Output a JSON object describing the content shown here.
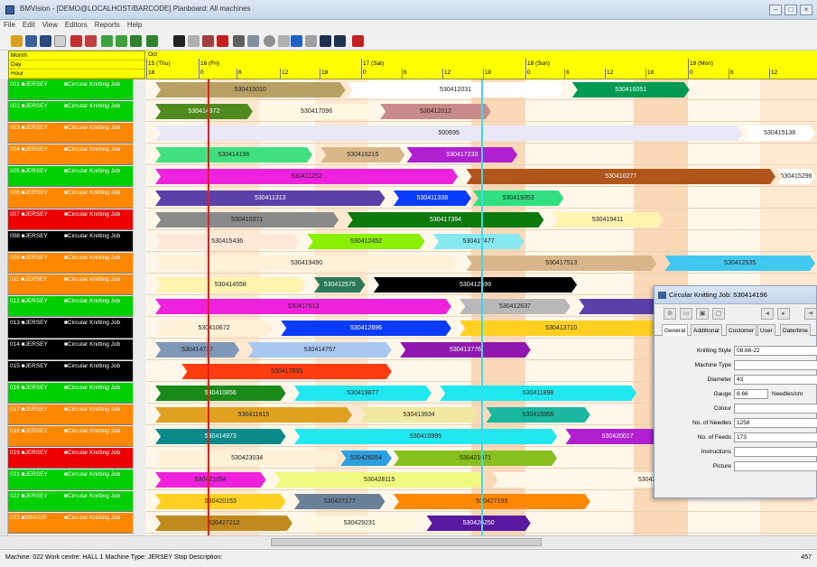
{
  "window": {
    "title": "BMVision - [DEMO@LOCALHOST/BARCODE] Planboard: All machines"
  },
  "menu": [
    "File",
    "Edit",
    "View",
    "Editors",
    "Reports",
    "Help"
  ],
  "timeline": {
    "labels": {
      "month": "Month",
      "day": "Day",
      "hour": "Hour"
    },
    "month": "Oct",
    "days": [
      "15 (Thu)",
      "16 (Fri)",
      "17 (Sat)",
      "18 (Sun)",
      "19 (Mon)"
    ],
    "hours": [
      "18",
      "0",
      "6",
      "12",
      "18",
      "0",
      "6",
      "12",
      "18",
      "0",
      "6",
      "12",
      "18",
      "0",
      "6",
      "12"
    ]
  },
  "machines": [
    {
      "id": "001",
      "type": "JERSEY",
      "job": "Circular Knitting Job",
      "color": "#00d000"
    },
    {
      "id": "002",
      "type": "JERSEY",
      "job": "Circular Knitting Job",
      "color": "#00d000"
    },
    {
      "id": "003",
      "type": "JERSEY",
      "job": "Circular Knitting Job",
      "color": "#ff8800"
    },
    {
      "id": "004",
      "type": "JERSEY",
      "job": "Circular Knitting Job",
      "color": "#ff8800"
    },
    {
      "id": "005",
      "type": "JERSEY",
      "job": "Circular Knitting Job",
      "color": "#00d000"
    },
    {
      "id": "006",
      "type": "JERSEY",
      "job": "Circular Knitting Job",
      "color": "#ff8800"
    },
    {
      "id": "007",
      "type": "JERSEY",
      "job": "Circular Knitting Job",
      "color": "#ee0000"
    },
    {
      "id": "008",
      "type": "JERSEY",
      "job": "Circular Knitting Job",
      "color": "#000000"
    },
    {
      "id": "009",
      "type": "JERSEY",
      "job": "Circular Knitting Job",
      "color": "#ff8800"
    },
    {
      "id": "011",
      "type": "JERSEY",
      "job": "Circular Knitting Job",
      "color": "#ff8800"
    },
    {
      "id": "012",
      "type": "JERSEY",
      "job": "Circular Knitting Job",
      "color": "#00d000"
    },
    {
      "id": "013",
      "type": "JERSEY",
      "job": "Circular Knitting Job",
      "color": "#000000"
    },
    {
      "id": "014",
      "type": "JERSEY",
      "job": "Circular Knitting Job",
      "color": "#000000"
    },
    {
      "id": "015",
      "type": "JERSEY",
      "job": "Circular Knitting Job",
      "color": "#000000"
    },
    {
      "id": "016",
      "type": "JERSEY",
      "job": "Circular Knitting Job",
      "color": "#00d000"
    },
    {
      "id": "017",
      "type": "JERSEY",
      "job": "Circular Knitting Job",
      "color": "#ff8800"
    },
    {
      "id": "018",
      "type": "JERSEY",
      "job": "Circular Knitting Job",
      "color": "#ff8800"
    },
    {
      "id": "019",
      "type": "JERSEY",
      "job": "Circular Knitting Job",
      "color": "#ee0000"
    },
    {
      "id": "021",
      "type": "JERSEY",
      "job": "Circular Knitting Job",
      "color": "#00d000"
    },
    {
      "id": "022",
      "type": "JERSEY",
      "job": "Circular Knitting Job",
      "color": "#00d000"
    },
    {
      "id": "023",
      "type": "SINKER",
      "job": "Circular Knitting Job",
      "color": "#ff8800"
    }
  ],
  "jobs": [
    [
      {
        "label": "530415010",
        "color": "#b8a062",
        "s": 0.0,
        "e": 0.29
      },
      {
        "label": "530412031",
        "color": "#ffffff",
        "s": 0.29,
        "e": 0.62
      },
      {
        "label": "530416051",
        "color": "#009a52",
        "s": 0.63,
        "e": 0.81
      }
    ],
    [
      {
        "label": "530414372",
        "color": "#4f8a1f",
        "s": 0.0,
        "e": 0.15
      },
      {
        "label": "530417096",
        "color": "#fff7e0",
        "s": 0.16,
        "e": 0.33
      },
      {
        "label": "530412012",
        "color": "#c98a8a",
        "s": 0.34,
        "e": 0.51
      }
    ],
    [
      {
        "label": "500695",
        "color": "#e8e8f8",
        "s": 0.0,
        "e": 0.89
      },
      {
        "label": "530415138",
        "color": "#ffffff",
        "s": 0.89,
        "e": 1.0
      }
    ],
    [
      {
        "label": "530414196",
        "color": "#40e080",
        "s": 0.0,
        "e": 0.24
      },
      {
        "label": "530416215",
        "color": "#d8b68a",
        "s": 0.25,
        "e": 0.38
      },
      {
        "label": "530417233",
        "color": "#b020d0",
        "s": 0.38,
        "e": 0.55
      }
    ],
    [
      {
        "label": "530411252",
        "color": "#ee22dd",
        "s": 0.0,
        "e": 0.46
      },
      {
        "label": "530410277",
        "color": "#b0551c",
        "s": 0.47,
        "e": 0.94
      },
      {
        "label": "530415296",
        "color": "#ffffff",
        "s": 0.94,
        "e": 1.0
      }
    ],
    [
      {
        "label": "530411313",
        "color": "#5a40a8",
        "s": 0.0,
        "e": 0.35
      },
      {
        "label": "530411338",
        "color": "#0a3cff",
        "s": 0.36,
        "e": 0.48
      },
      {
        "label": "530419353",
        "color": "#30e080",
        "s": 0.48,
        "e": 0.62
      }
    ],
    [
      {
        "label": "530410371",
        "color": "#8a8a8a",
        "s": 0.0,
        "e": 0.28
      },
      {
        "label": "530417394",
        "color": "#0c7a0c",
        "s": 0.29,
        "e": 0.59
      },
      {
        "label": "530419411",
        "color": "#fff3b0",
        "s": 0.6,
        "e": 0.77
      }
    ],
    [
      {
        "label": "530415436",
        "color": "#ffe8d8",
        "s": 0.0,
        "e": 0.22
      },
      {
        "label": "530412452",
        "color": "#88f000",
        "s": 0.23,
        "e": 0.41
      },
      {
        "label": "530417477",
        "color": "#88e8f0",
        "s": 0.42,
        "e": 0.56
      }
    ],
    [
      {
        "label": "530419490",
        "color": "#fff0d8",
        "s": 0.0,
        "e": 0.46
      },
      {
        "label": "530417513",
        "color": "#d8b68a",
        "s": 0.47,
        "e": 0.76
      },
      {
        "label": "530412535",
        "color": "#40c8f0",
        "s": 0.77,
        "e": 1.0
      }
    ],
    [
      {
        "label": "530414558",
        "color": "#fff3b0",
        "s": 0.0,
        "e": 0.23
      },
      {
        "label": "530412579",
        "color": "#2a7a5a",
        "s": 0.24,
        "e": 0.32
      },
      {
        "label": "530412599",
        "color": "#000000",
        "s": 0.33,
        "e": 0.64
      }
    ],
    [
      {
        "label": "530417613",
        "color": "#ee22dd",
        "s": 0.0,
        "e": 0.45
      },
      {
        "label": "530412637",
        "color": "#b8b8b8",
        "s": 0.46,
        "e": 0.63
      },
      {
        "label": "",
        "color": "#5a40a8",
        "s": 0.64,
        "e": 0.78
      }
    ],
    [
      {
        "label": "530410672",
        "color": "#fff0d8",
        "s": 0.0,
        "e": 0.18
      },
      {
        "label": "530412696",
        "color": "#0a3cff",
        "s": 0.19,
        "e": 0.45
      },
      {
        "label": "530413710",
        "color": "#ffd020",
        "s": 0.46,
        "e": 0.77
      }
    ],
    [
      {
        "label": "530414737",
        "color": "#8098b8",
        "s": 0.0,
        "e": 0.13
      },
      {
        "label": "530414757",
        "color": "#a8c8f0",
        "s": 0.14,
        "e": 0.36
      },
      {
        "label": "530413776",
        "color": "#9018b0",
        "s": 0.37,
        "e": 0.57
      }
    ],
    [
      {
        "label": "530417835",
        "color": "#ff3c10",
        "s": 0.04,
        "e": 0.36
      }
    ],
    [
      {
        "label": "530410856",
        "color": "#1a8a1a",
        "s": 0.0,
        "e": 0.2
      },
      {
        "label": "530419877",
        "color": "#20e8f0",
        "s": 0.21,
        "e": 0.42
      },
      {
        "label": "530411898",
        "color": "#20e8f0",
        "s": 0.43,
        "e": 0.73
      }
    ],
    [
      {
        "label": "530411915",
        "color": "#e0a020",
        "s": 0.0,
        "e": 0.3
      },
      {
        "label": "530413934",
        "color": "#f0e8a0",
        "s": 0.31,
        "e": 0.49
      },
      {
        "label": "530415955",
        "color": "#1ab8a0",
        "s": 0.5,
        "e": 0.66
      }
    ],
    [
      {
        "label": "530414973",
        "color": "#0a8a8a",
        "s": 0.0,
        "e": 0.2
      },
      {
        "label": "530410995",
        "color": "#20e8f0",
        "s": 0.21,
        "e": 0.61
      },
      {
        "label": "530420017",
        "color": "#b020d0",
        "s": 0.62,
        "e": 0.78
      }
    ],
    [
      {
        "label": "530423034",
        "color": "#fff0d8",
        "s": 0.0,
        "e": 0.28
      },
      {
        "label": "530426054",
        "color": "#2aa0e0",
        "s": 0.28,
        "e": 0.36
      },
      {
        "label": "530421071",
        "color": "#88c020",
        "s": 0.36,
        "e": 0.61
      }
    ],
    [
      {
        "label": "530421094",
        "color": "#ee22dd",
        "s": 0.0,
        "e": 0.17
      },
      {
        "label": "530428115",
        "color": "#f0f880",
        "s": 0.18,
        "e": 0.5
      },
      {
        "label": "530420134",
        "color": "#fff8e8",
        "s": 0.51,
        "e": 1.0
      }
    ],
    [
      {
        "label": "530420153",
        "color": "#ffd020",
        "s": 0.0,
        "e": 0.2
      },
      {
        "label": "530427177",
        "color": "#6a8098",
        "s": 0.21,
        "e": 0.35
      },
      {
        "label": "530427199",
        "color": "#ff8800",
        "s": 0.36,
        "e": 0.66
      }
    ],
    [
      {
        "label": "530427212",
        "color": "#c08a20",
        "s": 0.0,
        "e": 0.21
      },
      {
        "label": "530429231",
        "color": "#fff8e0",
        "s": 0.22,
        "e": 0.4
      },
      {
        "label": "530426250",
        "color": "#5a18a0",
        "s": 0.41,
        "e": 0.57
      }
    ]
  ],
  "panel": {
    "title": "Circular Knitting Job: 530414196",
    "tabs": [
      "General",
      "Additional",
      "Customer",
      "User",
      "Date/time"
    ],
    "fields": [
      {
        "label": "Knitting Style",
        "value": "08.66-22"
      },
      {
        "label": "Machine Type",
        "value": ""
      },
      {
        "label": "Diameter",
        "value": "43"
      },
      {
        "label": "Gauge",
        "value": "8.66",
        "unit": "Needles/cm"
      },
      {
        "label": "Colour",
        "value": ""
      },
      {
        "label": "No. of Needles",
        "value": "1258"
      },
      {
        "label": "No. of Feeds",
        "value": "173"
      },
      {
        "label": "Instructions",
        "value": ""
      },
      {
        "label": "Picture",
        "value": ""
      }
    ]
  },
  "status": {
    "text": "Machine: 022  Work centre: HALL 1  Machine Type: JERSEY  Stop Description:",
    "right": "457"
  },
  "markers": {
    "red": "#e02020",
    "cyan": "#40d8e8"
  }
}
